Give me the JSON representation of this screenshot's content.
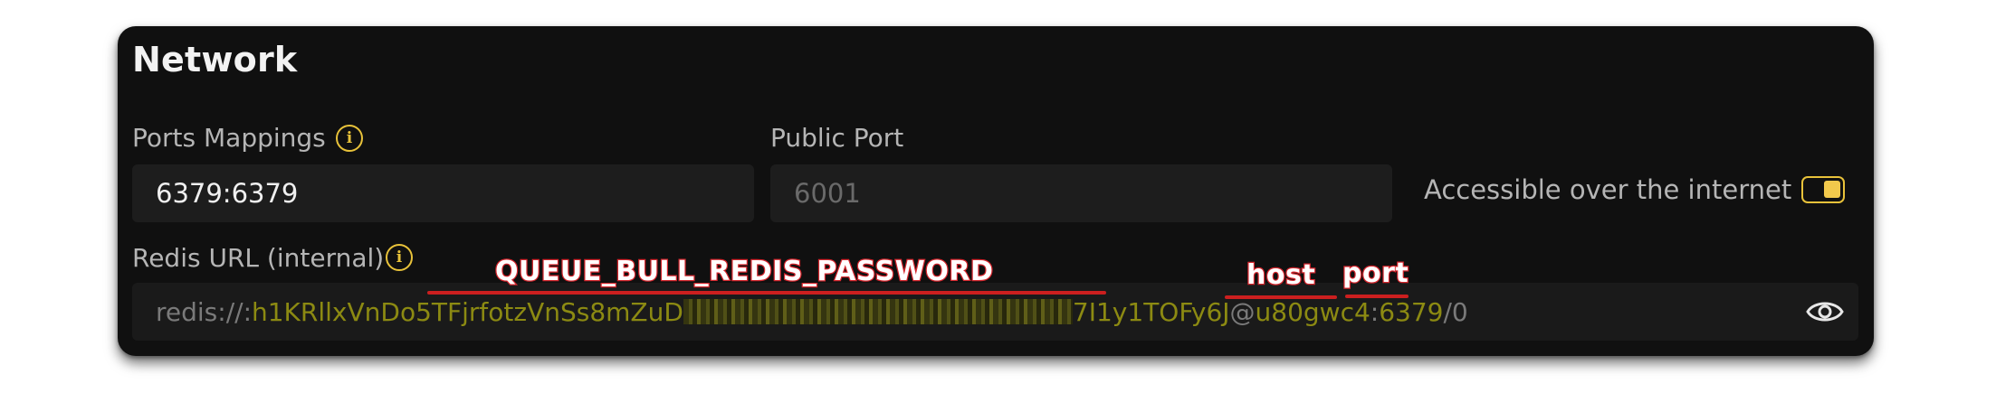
{
  "section": {
    "title": "Network"
  },
  "ports_mappings": {
    "label": "Ports Mappings",
    "value": "6379:6379"
  },
  "public_port": {
    "label": "Public Port",
    "placeholder": "6001"
  },
  "accessible": {
    "label": "Accessible over the internet",
    "enabled": true
  },
  "redis_url": {
    "label": "Redis URL (internal)",
    "scheme": "redis://:",
    "secret_visible_start": "h1KRllxVnDo5TFjrfotzVnSs8mZuD",
    "secret_visible_end": "7I1y1TOFy6J",
    "at": "@",
    "host": "u80gwc4",
    "colon": ":",
    "port": "6379",
    "db_path": "/0"
  },
  "annotations": {
    "password": "QUEUE_BULL_REDIS_PASSWORD",
    "host": "host",
    "port": "port"
  },
  "colors": {
    "accent": "#e8c23a",
    "url_highlight": "#8c8a12",
    "annotation": "#d4262d"
  },
  "icons": [
    "info-icon",
    "eye-icon"
  ]
}
